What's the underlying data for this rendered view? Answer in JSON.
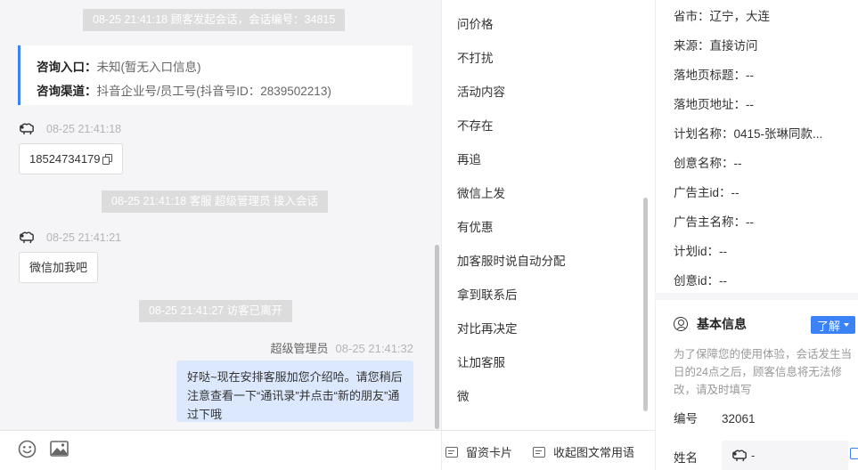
{
  "chat": {
    "system_start": "08-25 21:41:18 顾客发起会话，会话编号：34815",
    "entry_label": "咨询入口：",
    "entry_value": "未知(暂无入口信息)",
    "channel_label": "咨询渠道：",
    "channel_value": "抖音企业号/员工号(抖音号ID：2839502213)",
    "visitor_msg1_time": "08-25 21:41:18",
    "visitor_msg1_text": "18524734179",
    "system_join": "08-25 21:41:18 客服 超级管理员 接入会话",
    "visitor_msg2_time": "08-25 21:41:21",
    "visitor_msg2_text": "微信加我吧",
    "system_leave": "08-25 21:41:27 访客已离开",
    "agent_name": "超级管理员",
    "agent_time": "08-25 21:41:32",
    "agent_msg": "好哒~现在安排客服加您介绍哈。请您稍后注意查看一下“通讯录”并点击“新的朋友”通过下哦"
  },
  "quick_replies": [
    "问价格",
    "不打扰",
    "活动内容",
    "不存在",
    "再追",
    "微信上发",
    "有优惠",
    "加客服时说自动分配",
    "拿到联系后",
    "对比再决定",
    "让加客服",
    "微"
  ],
  "quick_footer": {
    "card": "留资卡片",
    "collect": "收起图文常用语"
  },
  "info": {
    "province": "省市：辽宁，大连",
    "source": "来源：直接访问",
    "landing_title": "落地页标题：--",
    "landing_url": "落地页地址：--",
    "plan_name": "计划名称：0415-张琳同款...",
    "creative_name": "创意名称：--",
    "advertiser_id": "广告主id：--",
    "advertiser_name": "广告主名称：--",
    "plan_id": "计划id：--",
    "creative_id": "创意id：--"
  },
  "basic": {
    "title": "基本信息",
    "learn": "了解",
    "notice": "为了保障您的使用体验，会话发生当日的24点之后，顾客信息将无法修改，请及时填写",
    "id_label": "编号",
    "id_value": "32061",
    "name_label": "姓名",
    "name_value": "-"
  },
  "colors": {
    "accent": "#3b82f6",
    "agent_bubble": "#dce8fd",
    "system_bg": "#dcdcdc"
  }
}
